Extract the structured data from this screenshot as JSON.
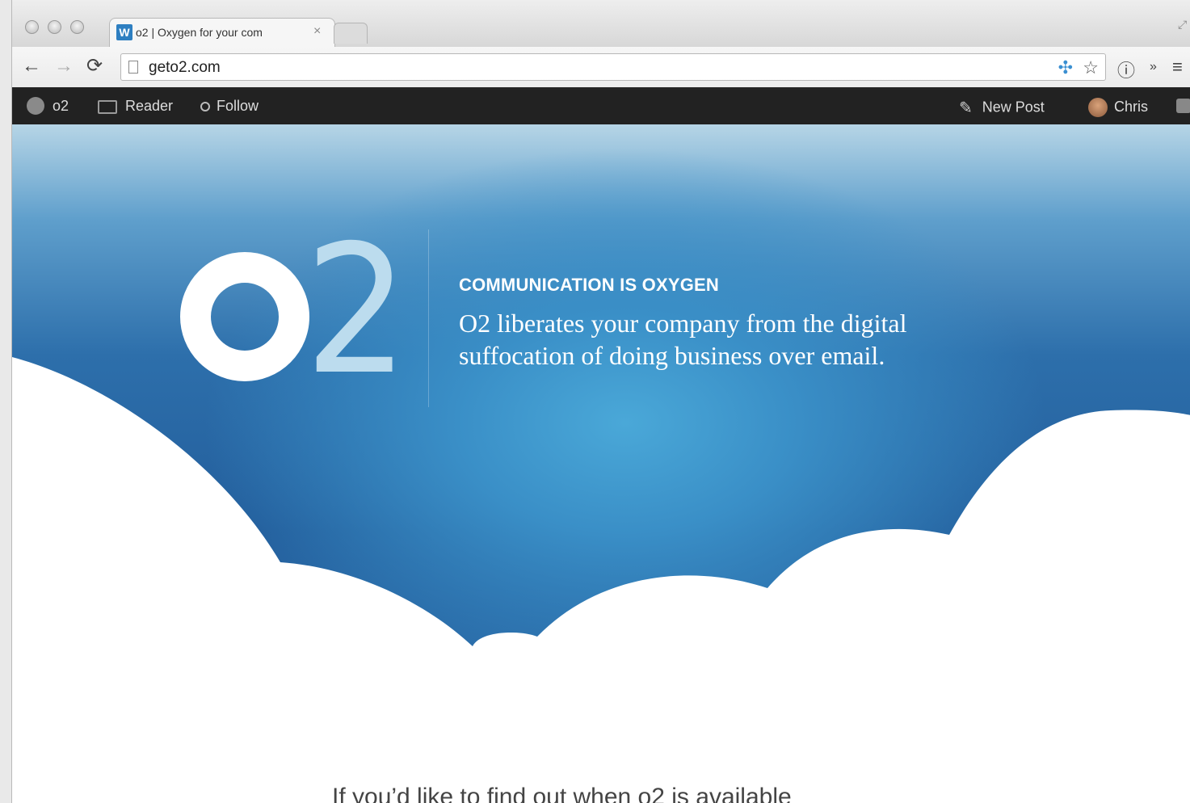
{
  "browser": {
    "tab_title": "o2 | Oxygen for your com",
    "tab_favicon": "W",
    "tab_close": "×",
    "url": "geto2.com"
  },
  "adminbar": {
    "site_name": "o2",
    "reader_label": "Reader",
    "follow_label": "Follow",
    "new_post_label": "New Post",
    "user_name": "Chris"
  },
  "hero": {
    "logo_o": "o",
    "logo_2": "2",
    "kicker": "COMMUNICATION IS OXYGEN",
    "body": "O2 liberates your company from the digital suffocation of doing business over email."
  },
  "below_fold": {
    "text": "If you’d like to find out when o2 is available"
  },
  "colors": {
    "hero_blue": "#235e9c",
    "hero_light": "#4aa8d8",
    "adminbar": "#222222"
  }
}
